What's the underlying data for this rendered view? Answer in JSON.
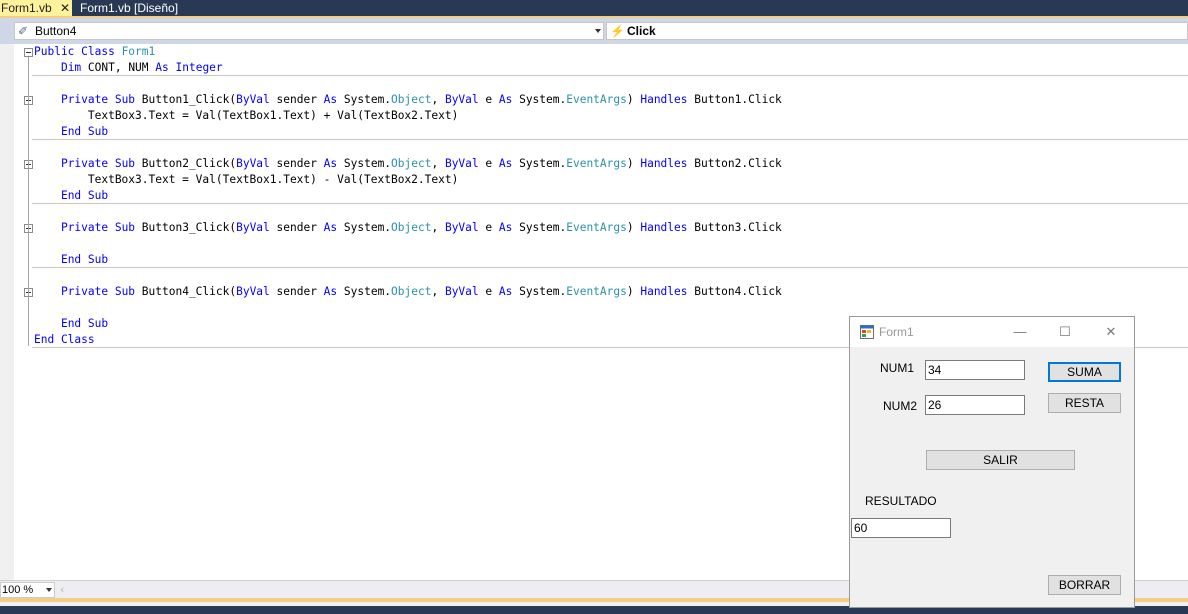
{
  "tabs": [
    {
      "label": "Form1.vb",
      "close_glyph": "✕",
      "active": true
    },
    {
      "label": "Form1.vb [Diseño]",
      "active": false
    }
  ],
  "navbar": {
    "object_combo": {
      "value": "Button4",
      "icon": "component-icon"
    },
    "event_combo": {
      "value": "Click",
      "icon": "lightning-event-icon"
    }
  },
  "code_lines": [
    [
      {
        "t": "Public Class ",
        "c": "kw"
      },
      {
        "t": "Form1",
        "c": "ty"
      }
    ],
    [
      {
        "t": "    "
      },
      {
        "t": "Dim",
        "c": "kw"
      },
      {
        "t": " CONT, NUM "
      },
      {
        "t": "As",
        "c": "kw"
      },
      {
        "t": " "
      },
      {
        "t": "Integer",
        "c": "kw"
      }
    ],
    [],
    [
      {
        "t": "    "
      },
      {
        "t": "Private Sub",
        "c": "kw"
      },
      {
        "t": " Button1_Click("
      },
      {
        "t": "ByVal",
        "c": "kw"
      },
      {
        "t": " sender "
      },
      {
        "t": "As",
        "c": "kw"
      },
      {
        "t": " System."
      },
      {
        "t": "Object",
        "c": "ty"
      },
      {
        "t": ", "
      },
      {
        "t": "ByVal",
        "c": "kw"
      },
      {
        "t": " e "
      },
      {
        "t": "As",
        "c": "kw"
      },
      {
        "t": " System."
      },
      {
        "t": "EventArgs",
        "c": "ty"
      },
      {
        "t": ") "
      },
      {
        "t": "Handles",
        "c": "kw"
      },
      {
        "t": " Button1.Click"
      }
    ],
    [
      {
        "t": "        TextBox3.Text = Val(TextBox1.Text) + Val(TextBox2.Text)"
      }
    ],
    [
      {
        "t": "    "
      },
      {
        "t": "End Sub",
        "c": "kw"
      }
    ],
    [],
    [
      {
        "t": "    "
      },
      {
        "t": "Private Sub",
        "c": "kw"
      },
      {
        "t": " Button2_Click("
      },
      {
        "t": "ByVal",
        "c": "kw"
      },
      {
        "t": " sender "
      },
      {
        "t": "As",
        "c": "kw"
      },
      {
        "t": " System."
      },
      {
        "t": "Object",
        "c": "ty"
      },
      {
        "t": ", "
      },
      {
        "t": "ByVal",
        "c": "kw"
      },
      {
        "t": " e "
      },
      {
        "t": "As",
        "c": "kw"
      },
      {
        "t": " System."
      },
      {
        "t": "EventArgs",
        "c": "ty"
      },
      {
        "t": ") "
      },
      {
        "t": "Handles",
        "c": "kw"
      },
      {
        "t": " Button2.Click"
      }
    ],
    [
      {
        "t": "        TextBox3.Text = Val(TextBox1.Text) - Val(TextBox2.Text)"
      }
    ],
    [
      {
        "t": "    "
      },
      {
        "t": "End Sub",
        "c": "kw"
      }
    ],
    [],
    [
      {
        "t": "    "
      },
      {
        "t": "Private Sub",
        "c": "kw"
      },
      {
        "t": " Button3_Click("
      },
      {
        "t": "ByVal",
        "c": "kw"
      },
      {
        "t": " sender "
      },
      {
        "t": "As",
        "c": "kw"
      },
      {
        "t": " System."
      },
      {
        "t": "Object",
        "c": "ty"
      },
      {
        "t": ", "
      },
      {
        "t": "ByVal",
        "c": "kw"
      },
      {
        "t": " e "
      },
      {
        "t": "As",
        "c": "kw"
      },
      {
        "t": " System."
      },
      {
        "t": "EventArgs",
        "c": "ty"
      },
      {
        "t": ") "
      },
      {
        "t": "Handles",
        "c": "kw"
      },
      {
        "t": " Button3.Click"
      }
    ],
    [],
    [
      {
        "t": "    "
      },
      {
        "t": "End Sub",
        "c": "kw"
      }
    ],
    [],
    [
      {
        "t": "    "
      },
      {
        "t": "Private Sub",
        "c": "kw"
      },
      {
        "t": " Button4_Click("
      },
      {
        "t": "ByVal",
        "c": "kw"
      },
      {
        "t": " sender "
      },
      {
        "t": "As",
        "c": "kw"
      },
      {
        "t": " System."
      },
      {
        "t": "Object",
        "c": "ty"
      },
      {
        "t": ", "
      },
      {
        "t": "ByVal",
        "c": "kw"
      },
      {
        "t": " e "
      },
      {
        "t": "As",
        "c": "kw"
      },
      {
        "t": " System."
      },
      {
        "t": "EventArgs",
        "c": "ty"
      },
      {
        "t": ") "
      },
      {
        "t": "Handles",
        "c": "kw"
      },
      {
        "t": " Button4.Click"
      }
    ],
    [],
    [
      {
        "t": "    "
      },
      {
        "t": "End Sub",
        "c": "kw"
      }
    ],
    [
      {
        "t": "End Class",
        "c": "kw"
      }
    ]
  ],
  "zoom": "100 %",
  "colors": {
    "keyword": "#0000ff",
    "type": "#2b91af",
    "tab_active": "#fff29d",
    "tab_strip": "#293955"
  },
  "form": {
    "title": "Form1",
    "minimize_glyph": "—",
    "maximize_glyph": "☐",
    "close_glyph": "✕",
    "num1_label": "NUM1",
    "num2_label": "NUM2",
    "num1_value": "34",
    "num2_value": "26",
    "suma_label": "SUMA",
    "resta_label": "RESTA",
    "salir_label": "SALIR",
    "resultado_label": "RESULTADO",
    "resultado_value": "60",
    "borrar_label": "BORRAR"
  }
}
